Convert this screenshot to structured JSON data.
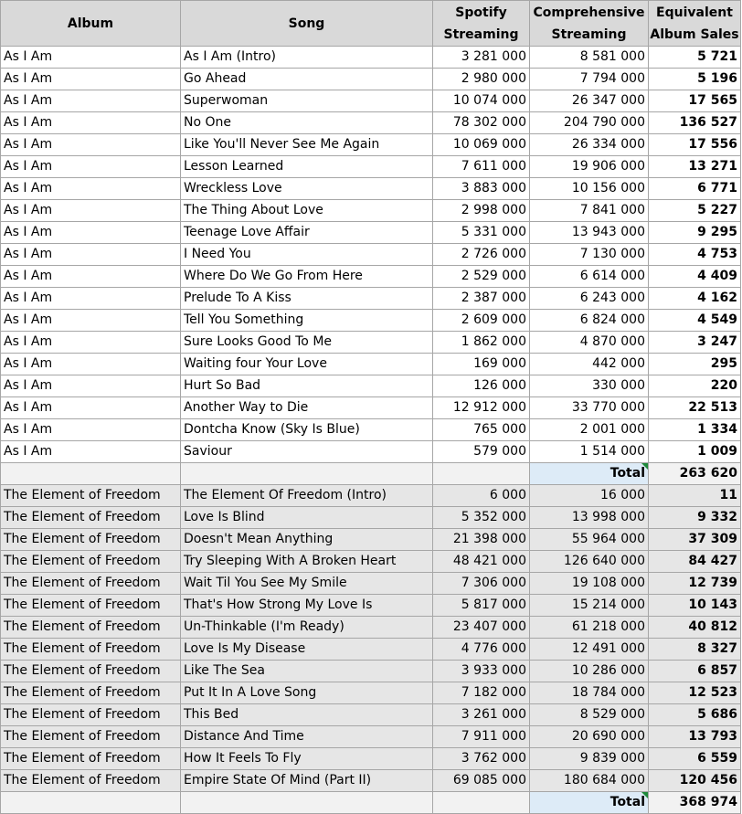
{
  "headers": {
    "album": "Album",
    "song": "Song",
    "spotify": [
      "Spotify",
      "Streaming"
    ],
    "comprehensive": [
      "Comprehensive",
      "Streaming"
    ],
    "eas": [
      "Equivalent",
      "Album Sales"
    ]
  },
  "total_label": "Total",
  "groups": [
    {
      "total": "263 620",
      "rows": [
        [
          "As I Am",
          "As I Am (Intro)",
          "3 281 000",
          "8 581 000",
          "5 721"
        ],
        [
          "As I Am",
          "Go Ahead",
          "2 980 000",
          "7 794 000",
          "5 196"
        ],
        [
          "As I Am",
          "Superwoman",
          "10 074 000",
          "26 347 000",
          "17 565"
        ],
        [
          "As I Am",
          "No One",
          "78 302 000",
          "204 790 000",
          "136 527"
        ],
        [
          "As I Am",
          "Like You'll Never See Me Again",
          "10 069 000",
          "26 334 000",
          "17 556"
        ],
        [
          "As I Am",
          "Lesson Learned",
          "7 611 000",
          "19 906 000",
          "13 271"
        ],
        [
          "As I Am",
          "Wreckless Love",
          "3 883 000",
          "10 156 000",
          "6 771"
        ],
        [
          "As I Am",
          "The Thing About Love",
          "2 998 000",
          "7 841 000",
          "5 227"
        ],
        [
          "As I Am",
          "Teenage Love Affair",
          "5 331 000",
          "13 943 000",
          "9 295"
        ],
        [
          "As I Am",
          "I Need You",
          "2 726 000",
          "7 130 000",
          "4 753"
        ],
        [
          "As I Am",
          "Where Do We Go From Here",
          "2 529 000",
          "6 614 000",
          "4 409"
        ],
        [
          "As I Am",
          "Prelude To A Kiss",
          "2 387 000",
          "6 243 000",
          "4 162"
        ],
        [
          "As I Am",
          "Tell You Something",
          "2 609 000",
          "6 824 000",
          "4 549"
        ],
        [
          "As I Am",
          "Sure Looks Good To Me",
          "1 862 000",
          "4 870 000",
          "3 247"
        ],
        [
          "As I Am",
          "Waiting four Your Love",
          "169 000",
          "442 000",
          "295"
        ],
        [
          "As I Am",
          "Hurt So Bad",
          "126 000",
          "330 000",
          "220"
        ],
        [
          "As I Am",
          "Another Way to Die",
          "12 912 000",
          "33 770 000",
          "22 513"
        ],
        [
          "As I Am",
          "Dontcha Know (Sky Is Blue)",
          "765 000",
          "2 001 000",
          "1 334"
        ],
        [
          "As I Am",
          "Saviour",
          "579 000",
          "1 514 000",
          "1 009"
        ]
      ]
    },
    {
      "total": "368 974",
      "rows": [
        [
          "The Element of Freedom",
          "The Element Of Freedom (Intro)",
          "6 000",
          "16 000",
          "11"
        ],
        [
          "The Element of Freedom",
          "Love Is Blind",
          "5 352 000",
          "13 998 000",
          "9 332"
        ],
        [
          "The Element of Freedom",
          "Doesn't Mean Anything",
          "21 398 000",
          "55 964 000",
          "37 309"
        ],
        [
          "The Element of Freedom",
          "Try Sleeping With A Broken Heart",
          "48 421 000",
          "126 640 000",
          "84 427"
        ],
        [
          "The Element of Freedom",
          "Wait Til You See My Smile",
          "7 306 000",
          "19 108 000",
          "12 739"
        ],
        [
          "The Element of Freedom",
          "That's How Strong My Love Is",
          "5 817 000",
          "15 214 000",
          "10 143"
        ],
        [
          "The Element of Freedom",
          "Un-Thinkable (I'm Ready)",
          "23 407 000",
          "61 218 000",
          "40 812"
        ],
        [
          "The Element of Freedom",
          "Love Is My Disease",
          "4 776 000",
          "12 491 000",
          "8 327"
        ],
        [
          "The Element of Freedom",
          "Like The Sea",
          "3 933 000",
          "10 286 000",
          "6 857"
        ],
        [
          "The Element of Freedom",
          "Put It In A Love Song",
          "7 182 000",
          "18 784 000",
          "12 523"
        ],
        [
          "The Element of Freedom",
          "This Bed",
          "3 261 000",
          "8 529 000",
          "5 686"
        ],
        [
          "The Element of Freedom",
          "Distance And Time",
          "7 911 000",
          "20 690 000",
          "13 793"
        ],
        [
          "The Element of Freedom",
          "How It Feels To Fly",
          "3 762 000",
          "9 839 000",
          "6 559"
        ],
        [
          "The Element of Freedom",
          "Empire State Of Mind (Part II)",
          "69 085 000",
          "180 684 000",
          "120 456"
        ]
      ]
    }
  ]
}
